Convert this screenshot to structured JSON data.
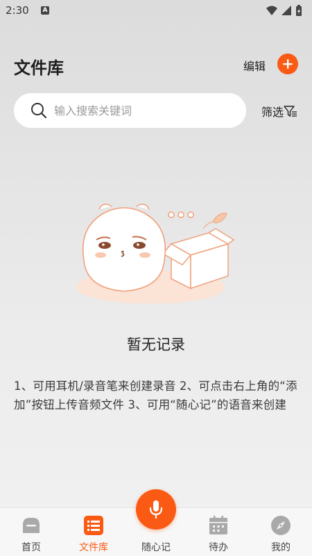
{
  "status_bar": {
    "time": "2:30",
    "notification_badge": "A",
    "icons": [
      "wifi-icon",
      "signal-icon",
      "battery-icon"
    ]
  },
  "header": {
    "title": "文件库",
    "edit_label": "编辑",
    "add_icon": "plus-icon",
    "accent_color": "#fa5a14"
  },
  "search": {
    "placeholder": "输入搜索关键词",
    "value": "",
    "filter_label": "筛选"
  },
  "empty_state": {
    "title": "暂无记录",
    "help_text": "1、可用耳机/录音笔来创建录音 2、可点击右上角的“添加”按钮上传音频文件 3、可用“随心记”的语音来创建"
  },
  "bottom_nav": {
    "items": [
      {
        "label": "首页",
        "icon": "home-icon",
        "active": false
      },
      {
        "label": "文件库",
        "icon": "list-icon",
        "active": true
      },
      {
        "label": "随心记",
        "icon": "microphone-icon",
        "active": false
      },
      {
        "label": "待办",
        "icon": "calendar-icon",
        "active": false
      },
      {
        "label": "我的",
        "icon": "compass-icon",
        "active": false
      }
    ]
  }
}
